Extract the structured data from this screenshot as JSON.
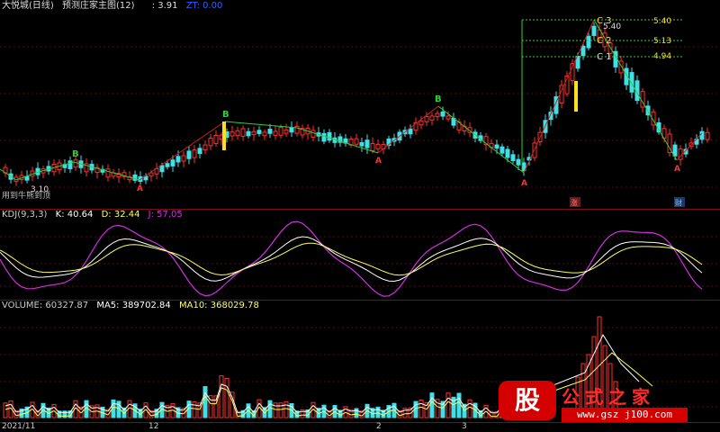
{
  "main": {
    "title": "大悦城(日线)",
    "indicator": "预测庄家主图(12)",
    "value1": ": 3.91",
    "value2": "ZT: 0.00",
    "bottom_label": "用到牛熊到顶",
    "low_label": "3.10",
    "levels": [
      {
        "name": "C 3",
        "value": "5.40"
      },
      {
        "name": "C 2",
        "value": "5.13"
      },
      {
        "name": "C 1",
        "value": "4.94"
      }
    ],
    "top_value": "5.40",
    "marker_b": "B",
    "marker_a": "A",
    "badge_zhang": "涨",
    "badge_cai": "财"
  },
  "kdj": {
    "name": "KDJ(9,3,3)",
    "k": "K: 40.64",
    "d": "D: 32.44",
    "j": "J: 57.05"
  },
  "volume": {
    "name": "VOLUME: 60327.87",
    "ma5": "MA5: 389702.84",
    "ma10": "MA10: 368029.78"
  },
  "axis": {
    "labels": [
      "2021/11",
      "12",
      "2",
      "3"
    ]
  },
  "logo": {
    "gu": "股",
    "name": "公式之家",
    "url": "www.gsz j100.com"
  },
  "colors": {
    "up": "#ff3030",
    "down": "#40e0e8",
    "grid": "#7a1010",
    "k_line": "#ffffff",
    "d_line": "#ffff60",
    "j_line": "#d030e0"
  }
}
